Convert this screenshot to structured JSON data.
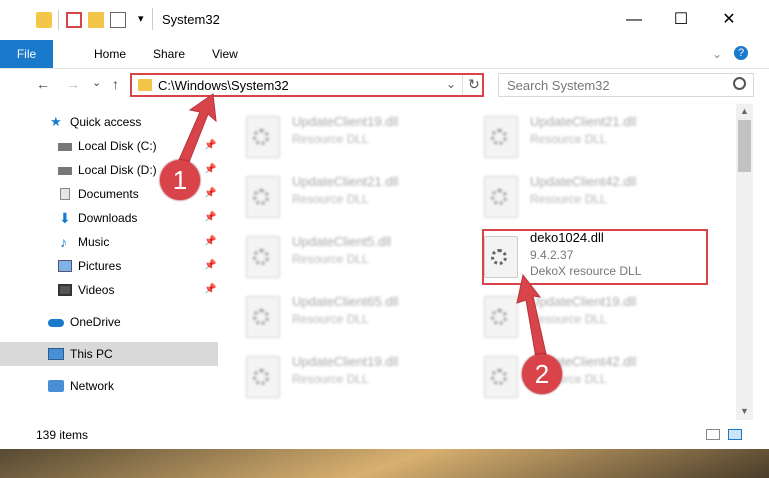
{
  "window": {
    "title": "System32",
    "minimize": "—",
    "maximize": "☐",
    "close": "✕"
  },
  "ribbon": {
    "tabs": [
      "File",
      "Home",
      "Share",
      "View"
    ],
    "help": "?"
  },
  "nav": {
    "back": "←",
    "forward": "→",
    "recent": "⌄",
    "up": "↑",
    "address": "C:\\Windows\\System32",
    "refresh": "↻",
    "dropdown": "⌄",
    "search_placeholder": "Search System32"
  },
  "sidebar": {
    "items": [
      {
        "label": "Quick access",
        "pinned": false
      },
      {
        "label": "Local Disk (C:)",
        "pinned": true
      },
      {
        "label": "Local Disk (D:)",
        "pinned": true
      },
      {
        "label": "Documents",
        "pinned": true
      },
      {
        "label": "Downloads",
        "pinned": true
      },
      {
        "label": "Music",
        "pinned": true
      },
      {
        "label": "Pictures",
        "pinned": true
      },
      {
        "label": "Videos",
        "pinned": true
      },
      {
        "label": "OneDrive",
        "pinned": false
      },
      {
        "label": "This PC",
        "pinned": false,
        "selected": true
      },
      {
        "label": "Network",
        "pinned": false
      }
    ]
  },
  "files": {
    "left": [
      {
        "name": "UpdateClient19.dll",
        "type": "Resource DLL"
      },
      {
        "name": "UpdateClient21.dll",
        "type": "Resource DLL"
      },
      {
        "name": "UpdateClient5.dll",
        "type": "Resource DLL"
      },
      {
        "name": "UpdateClient65.dll",
        "type": "Resource DLL"
      },
      {
        "name": "UpdateClient19.dll",
        "type": "Resource DLL"
      }
    ],
    "right": [
      {
        "name": "UpdateClient21.dll",
        "type": "Resource DLL"
      },
      {
        "name": "UpdateClient42.dll",
        "type": "Resource DLL"
      },
      {
        "name": "deko1024.dll",
        "version": "9.4.2.37",
        "type": "DekoX resource DLL"
      },
      {
        "name": "UpdateClient19.dll",
        "type": "Resource DLL"
      },
      {
        "name": "UpdateClient42.dll",
        "type": "Resource DLL"
      }
    ]
  },
  "status": {
    "count": "139 items"
  },
  "markers": [
    "1",
    "2"
  ],
  "colors": {
    "accent": "#1979ca",
    "highlight": "#d9444a"
  }
}
